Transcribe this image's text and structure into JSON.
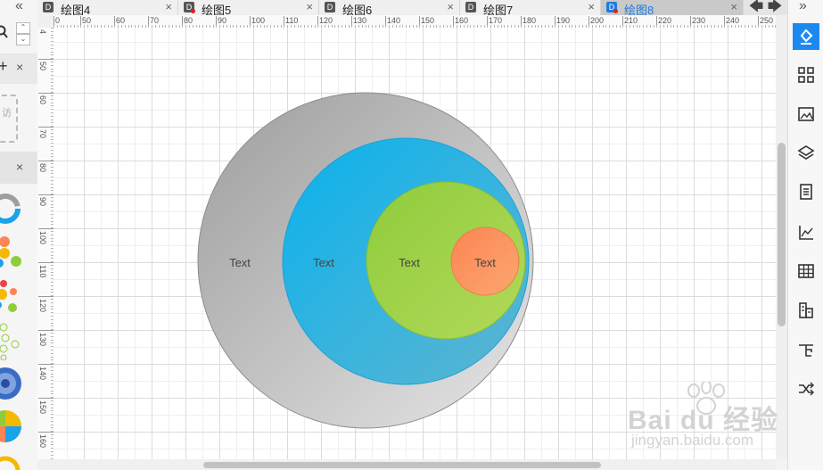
{
  "tabs": [
    {
      "label": "绘图4",
      "unsaved": false,
      "active": false
    },
    {
      "label": "绘图5",
      "unsaved": true,
      "active": false
    },
    {
      "label": "绘图6",
      "unsaved": false,
      "active": false
    },
    {
      "label": "绘图7",
      "unsaved": false,
      "active": false
    },
    {
      "label": "绘图8",
      "unsaved": true,
      "active": true
    }
  ],
  "tab_close": "×",
  "tab_nav": {
    "prev": "🡄",
    "next": "🡆"
  },
  "ruler": {
    "horizontal": [
      "0",
      "50",
      "60",
      "70",
      "80",
      "90",
      "100",
      "110",
      "120",
      "130",
      "140",
      "150",
      "160",
      "170",
      "180",
      "190",
      "200",
      "210",
      "220",
      "230",
      "240",
      "250"
    ],
    "vertical": [
      "4",
      "50",
      "60",
      "70",
      "80",
      "90",
      "100",
      "110",
      "120",
      "130",
      "140",
      "150",
      "160"
    ]
  },
  "diagram": {
    "circles": [
      {
        "label": "Text",
        "fill_start": "#9d9d9d",
        "fill_end": "#e6e6e6"
      },
      {
        "label": "Text",
        "fill_start": "#0ab2ee",
        "fill_end": "#5fb5cf"
      },
      {
        "label": "Text",
        "fill_start": "#8fcc3c",
        "fill_end": "#b2d959"
      },
      {
        "label": "Text",
        "fill_start": "#fd8454",
        "fill_end": "#faa870"
      }
    ]
  },
  "left_panel": {
    "collapse": "«",
    "close": "×",
    "add": "+",
    "placeholder_char": "访"
  },
  "right_toolbar": [
    "fill-icon",
    "grid-icon",
    "image-icon",
    "layers-icon",
    "page-icon",
    "chart-icon",
    "table-icon",
    "org-icon",
    "outline-icon",
    "shuffle-icon"
  ],
  "right_collapse": "»",
  "colors": {
    "accent": "#1e88f2"
  },
  "watermark": {
    "brand": "Bai du 经验",
    "url": "jingyan.baidu.com"
  }
}
